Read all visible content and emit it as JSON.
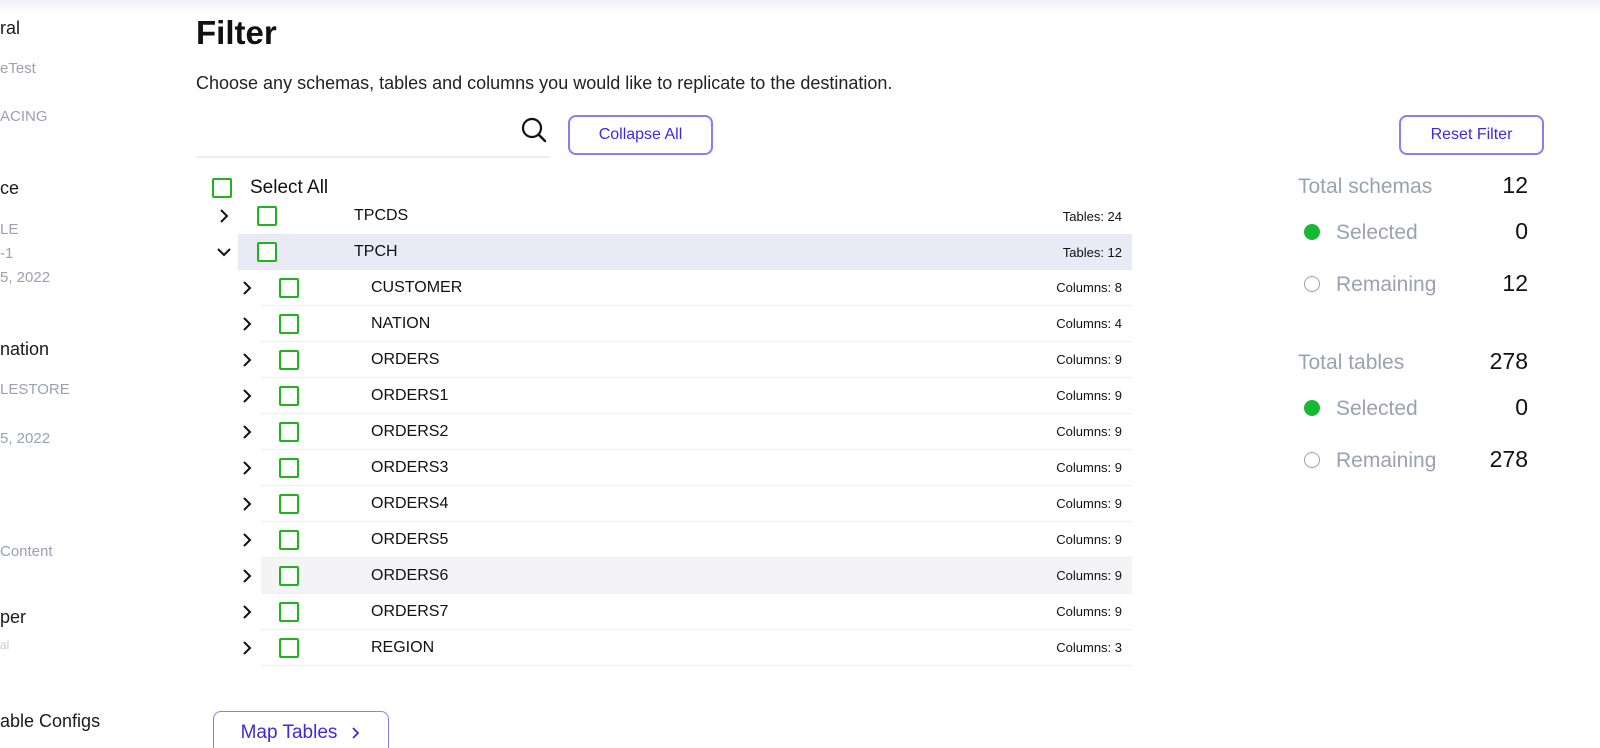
{
  "sidebar": {
    "items": [
      {
        "text": "ral",
        "style": "h"
      },
      {
        "text": "eTest",
        "style": "s"
      },
      {
        "text": "ACING",
        "style": "s"
      },
      {
        "text": "ce",
        "style": "h"
      },
      {
        "text": "LE",
        "style": "s"
      },
      {
        "text": "-1",
        "style": "s"
      },
      {
        "text": "5, 2022",
        "style": "s"
      },
      {
        "text": "nation",
        "style": "h"
      },
      {
        "text": "LESTORE",
        "style": "s"
      },
      {
        "text": "5, 2022",
        "style": "s"
      },
      {
        "text": "Content",
        "style": "s"
      },
      {
        "text": "per",
        "style": "h"
      },
      {
        "text": "al",
        "style": "xs"
      },
      {
        "text": "able Configs",
        "style": "h"
      }
    ]
  },
  "page": {
    "title": "Filter",
    "description": "Choose any schemas, tables and columns you would like to replicate to the destination."
  },
  "search": {
    "value": "",
    "placeholder": ""
  },
  "toolbar": {
    "collapse_label": "Collapse All",
    "reset_label": "Reset Filter"
  },
  "tree": {
    "select_all_label": "Select All",
    "schemas": [
      {
        "name": "TPCDS",
        "count": "Tables: 24",
        "expanded": false
      },
      {
        "name": "TPCH",
        "count": "Tables: 12",
        "expanded": true
      }
    ],
    "tables": [
      {
        "name": "CUSTOMER",
        "count": "Columns: 8"
      },
      {
        "name": "NATION",
        "count": "Columns: 4"
      },
      {
        "name": "ORDERS",
        "count": "Columns: 9"
      },
      {
        "name": "ORDERS1",
        "count": "Columns: 9"
      },
      {
        "name": "ORDERS2",
        "count": "Columns: 9"
      },
      {
        "name": "ORDERS3",
        "count": "Columns: 9"
      },
      {
        "name": "ORDERS4",
        "count": "Columns: 9"
      },
      {
        "name": "ORDERS5",
        "count": "Columns: 9"
      },
      {
        "name": "ORDERS6",
        "count": "Columns: 9"
      },
      {
        "name": "ORDERS7",
        "count": "Columns: 9"
      },
      {
        "name": "REGION",
        "count": "Columns: 3"
      }
    ]
  },
  "footer": {
    "map_tables_label": "Map Tables"
  },
  "stats": {
    "schemas": {
      "total_label": "Total schemas",
      "total": "12",
      "selected_label": "Selected",
      "selected": "0",
      "remaining_label": "Remaining",
      "remaining": "12"
    },
    "tables": {
      "total_label": "Total tables",
      "total": "278",
      "selected_label": "Selected",
      "selected": "0",
      "remaining_label": "Remaining",
      "remaining": "278"
    }
  },
  "colors": {
    "accent": "#3d2bd6",
    "accent_border": "#8b7cf0",
    "checkbox": "#1fb41f",
    "selected_dot": "#16b932",
    "muted": "#9aa1b2",
    "row_highlight": "#e9eaf6"
  },
  "icons": {
    "search": "search-icon",
    "expand": "chevron-right-icon",
    "collapse": "chevron-down-icon",
    "forward": "chevron-right-icon"
  }
}
